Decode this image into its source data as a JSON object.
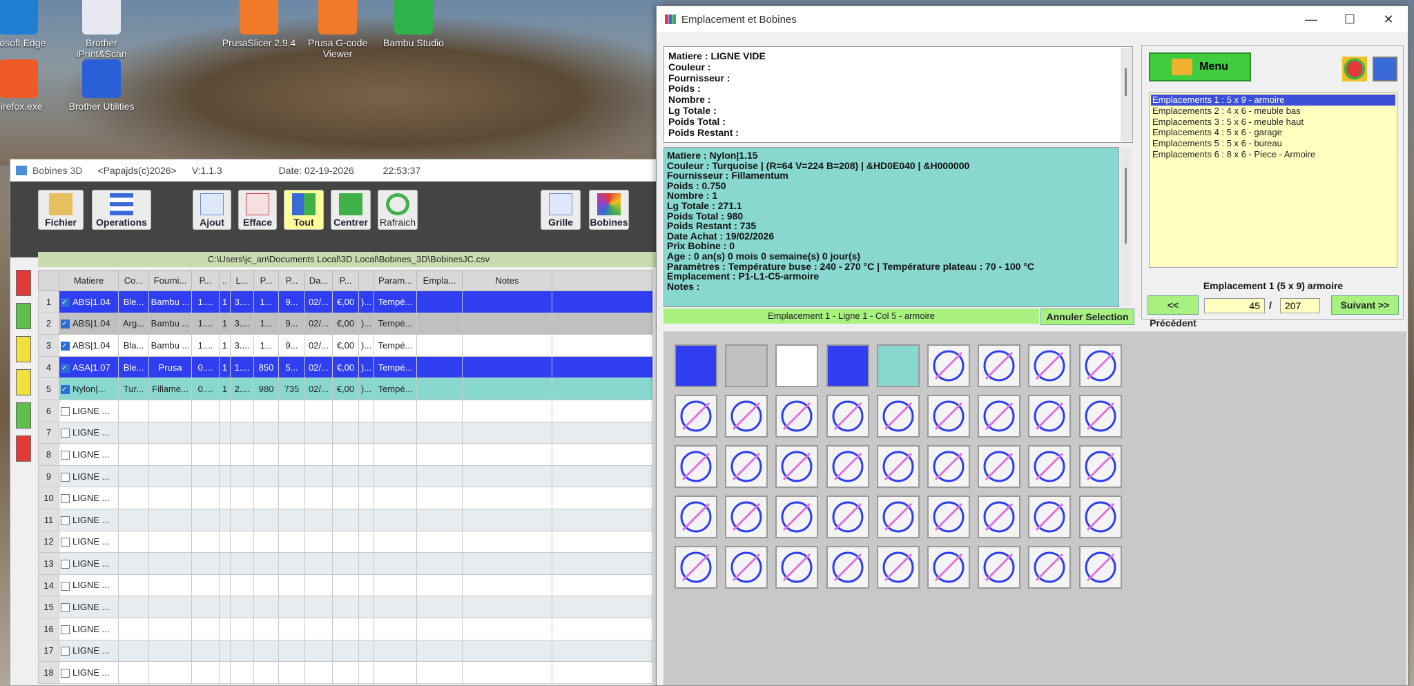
{
  "desktop": {
    "icons": [
      {
        "label": "crosoft Edge",
        "color": "#1e7fd4"
      },
      {
        "label": "Brother iPrint&Scan",
        "color": "#e8e8f0"
      },
      {
        "label": "PrusaSlicer 2.9.4",
        "color": "#f07a2a"
      },
      {
        "label": "Prusa G-code Viewer",
        "color": "#f07a2a"
      },
      {
        "label": "Bambu Studio",
        "color": "#2fb24a"
      },
      {
        "label": "Firefox.exe",
        "color": "#f05a28"
      },
      {
        "label": "Brother Utilities",
        "color": "#2a5fd8"
      }
    ]
  },
  "bobines": {
    "title": {
      "app": "Bobines 3D",
      "author": "<Papajds(c)2026>",
      "version": "V:1.1.3",
      "date": "Date: 02-19-2026",
      "time": "22:53:37"
    },
    "toolbar": {
      "fichier": "Fichier",
      "operations": "Operations",
      "ajout": "Ajout",
      "efface": "Efface",
      "tout": "Tout",
      "centrer": "Centrer",
      "rafraich": "Rafraich",
      "grille": "Grille",
      "bobines": "Bobines"
    },
    "path": "C:\\Users\\jc_an\\Documents Local\\3D Local\\Bobines_3D\\BobinesJC.csv",
    "columns": [
      "",
      "Matiere",
      "Co...",
      "Fourni...",
      "P...",
      "..",
      "L...",
      "P...",
      "P...",
      "Da...",
      "P...",
      "",
      "Param...",
      "Empla...",
      "Notes",
      ""
    ],
    "rows": [
      {
        "n": "1",
        "checked": true,
        "cells": [
          "ABS|1.04",
          "Ble...",
          "Bambu ...",
          "1....",
          "1",
          "3....",
          "1...",
          "9...",
          "02/...",
          "€,00",
          ")...",
          "Tempé...",
          "",
          "",
          ""
        ],
        "style": "sel"
      },
      {
        "n": "2",
        "checked": true,
        "cells": [
          "ABS|1.04",
          "Arg...",
          "Bambu ...",
          "1....",
          "1",
          "3....",
          "1...",
          "9...",
          "02/...",
          "€,00",
          ")...",
          "Tempé...",
          "",
          "",
          ""
        ],
        "style": "grey"
      },
      {
        "n": "3",
        "checked": true,
        "cells": [
          "ABS|1.04",
          "Bla...",
          "Bambu ...",
          "1....",
          "1",
          "3....",
          "1...",
          "9...",
          "02/...",
          "€,00",
          ")...",
          "Tempé...",
          "",
          "",
          ""
        ],
        "style": "white"
      },
      {
        "n": "4",
        "checked": true,
        "cells": [
          "ASA|1.07",
          "Ble...",
          "Prusa",
          "0....",
          "1",
          "1....",
          "850",
          "5...",
          "02/...",
          "€,00",
          ")...",
          "Tempé...",
          "",
          "",
          ""
        ],
        "style": "sel"
      },
      {
        "n": "5",
        "checked": true,
        "cells": [
          "Nylon|...",
          "Tur...",
          "Fillame...",
          "0....",
          "1",
          "2....",
          "980",
          "735",
          "02/...",
          "€,00",
          ")...",
          "Tempé...",
          "",
          "",
          ""
        ],
        "style": "teal"
      },
      {
        "n": "6",
        "checked": false,
        "cells": [
          "LIGNE ...",
          "",
          "",
          "",
          "",
          "",
          "",
          "",
          "",
          "",
          "",
          "",
          "",
          "",
          ""
        ],
        "style": "empty"
      },
      {
        "n": "7",
        "checked": false,
        "cells": [
          "LIGNE ...",
          "",
          "",
          "",
          "",
          "",
          "",
          "",
          "",
          "",
          "",
          "",
          "",
          "",
          ""
        ],
        "style": "empty"
      },
      {
        "n": "8",
        "checked": false,
        "cells": [
          "LIGNE ...",
          "",
          "",
          "",
          "",
          "",
          "",
          "",
          "",
          "",
          "",
          "",
          "",
          "",
          ""
        ],
        "style": "empty"
      },
      {
        "n": "9",
        "checked": false,
        "cells": [
          "LIGNE ...",
          "",
          "",
          "",
          "",
          "",
          "",
          "",
          "",
          "",
          "",
          "",
          "",
          "",
          ""
        ],
        "style": "empty"
      },
      {
        "n": "10",
        "checked": false,
        "cells": [
          "LIGNE ...",
          "",
          "",
          "",
          "",
          "",
          "",
          "",
          "",
          "",
          "",
          "",
          "",
          "",
          ""
        ],
        "style": "empty"
      },
      {
        "n": "11",
        "checked": false,
        "cells": [
          "LIGNE ...",
          "",
          "",
          "",
          "",
          "",
          "",
          "",
          "",
          "",
          "",
          "",
          "",
          "",
          ""
        ],
        "style": "empty"
      },
      {
        "n": "12",
        "checked": false,
        "cells": [
          "LIGNE ...",
          "",
          "",
          "",
          "",
          "",
          "",
          "",
          "",
          "",
          "",
          "",
          "",
          "",
          ""
        ],
        "style": "empty"
      },
      {
        "n": "13",
        "checked": false,
        "cells": [
          "LIGNE ...",
          "",
          "",
          "",
          "",
          "",
          "",
          "",
          "",
          "",
          "",
          "",
          "",
          "",
          ""
        ],
        "style": "empty"
      },
      {
        "n": "14",
        "checked": false,
        "cells": [
          "LIGNE ...",
          "",
          "",
          "",
          "",
          "",
          "",
          "",
          "",
          "",
          "",
          "",
          "",
          "",
          ""
        ],
        "style": "empty"
      },
      {
        "n": "15",
        "checked": false,
        "cells": [
          "LIGNE ...",
          "",
          "",
          "",
          "",
          "",
          "",
          "",
          "",
          "",
          "",
          "",
          "",
          "",
          ""
        ],
        "style": "empty"
      },
      {
        "n": "16",
        "checked": false,
        "cells": [
          "LIGNE ...",
          "",
          "",
          "",
          "",
          "",
          "",
          "",
          "",
          "",
          "",
          "",
          "",
          "",
          ""
        ],
        "style": "empty"
      },
      {
        "n": "17",
        "checked": false,
        "cells": [
          "LIGNE ...",
          "",
          "",
          "",
          "",
          "",
          "",
          "",
          "",
          "",
          "",
          "",
          "",
          "",
          ""
        ],
        "style": "empty"
      },
      {
        "n": "18",
        "checked": false,
        "cells": [
          "LIGNE ...",
          "",
          "",
          "",
          "",
          "",
          "",
          "",
          "",
          "",
          "",
          "",
          "",
          "",
          ""
        ],
        "style": "empty"
      }
    ]
  },
  "emplacement": {
    "title": "Emplacement et Bobines",
    "empty_lines": [
      "Matiere : LIGNE VIDE",
      "Couleur :",
      "Fournisseur :",
      "Poids :",
      "Nombre :",
      "Lg Totale :",
      "Poids Total :",
      "Poids Restant :"
    ],
    "info_lines": [
      "Matiere : Nylon|1.15",
      "Couleur : Turquoise | (R=64 V=224 B=208) | &HD0E040 | &H000000",
      "Fournisseur : Fillamentum",
      "Poids : 0.750",
      "Nombre : 1",
      "Lg Totale : 271.1",
      "Poids Total : 980",
      "Poids Restant : 735",
      "Date Achat : 19/02/2026",
      "Prix Bobine : 0",
      "Age : 0 an(s)  0 mois  0 semaine(s)  0 jour(s)",
      "Paramètres : Température buse : 240 - 270 °C | Température plateau : 70 - 100 °C",
      "Emplacement : P1-L1-C5-armoire",
      "Notes :"
    ],
    "location_bar": "Emplacement 1 - Ligne 1 - Col 5 - armoire",
    "annuler": "Annuler Selection",
    "menu": "Menu",
    "locations": [
      "Emplacements 1 : 5 x 9 - armoire",
      "Emplacements 2 : 4 x 6 - meuble bas",
      "Emplacements 3 : 5 x 6 - meuble haut",
      "Emplacements 4 : 5 x 6 - garage",
      "Emplacements 5 : 5 x 6 - bureau",
      "Emplacements 6 : 8 x 6 - Piece - Armoire"
    ],
    "selected_location_index": 0,
    "current_title": "Emplacement 1 (5 x 9) armoire",
    "prev": "<< Précédent",
    "next": "Suivant >>",
    "page_current": "45",
    "page_total": "207",
    "slash": "/",
    "grid": {
      "rows": 5,
      "cols": 9,
      "filled": [
        {
          "index": 0,
          "color": "#2e3ef0"
        },
        {
          "index": 1,
          "color": "#c0c0c0"
        },
        {
          "index": 2,
          "color": "#ffffff"
        },
        {
          "index": 3,
          "color": "#2e3ef0"
        },
        {
          "index": 4,
          "color": "#88d8d0"
        }
      ],
      "empty_icon": "no-spool-icon"
    }
  }
}
